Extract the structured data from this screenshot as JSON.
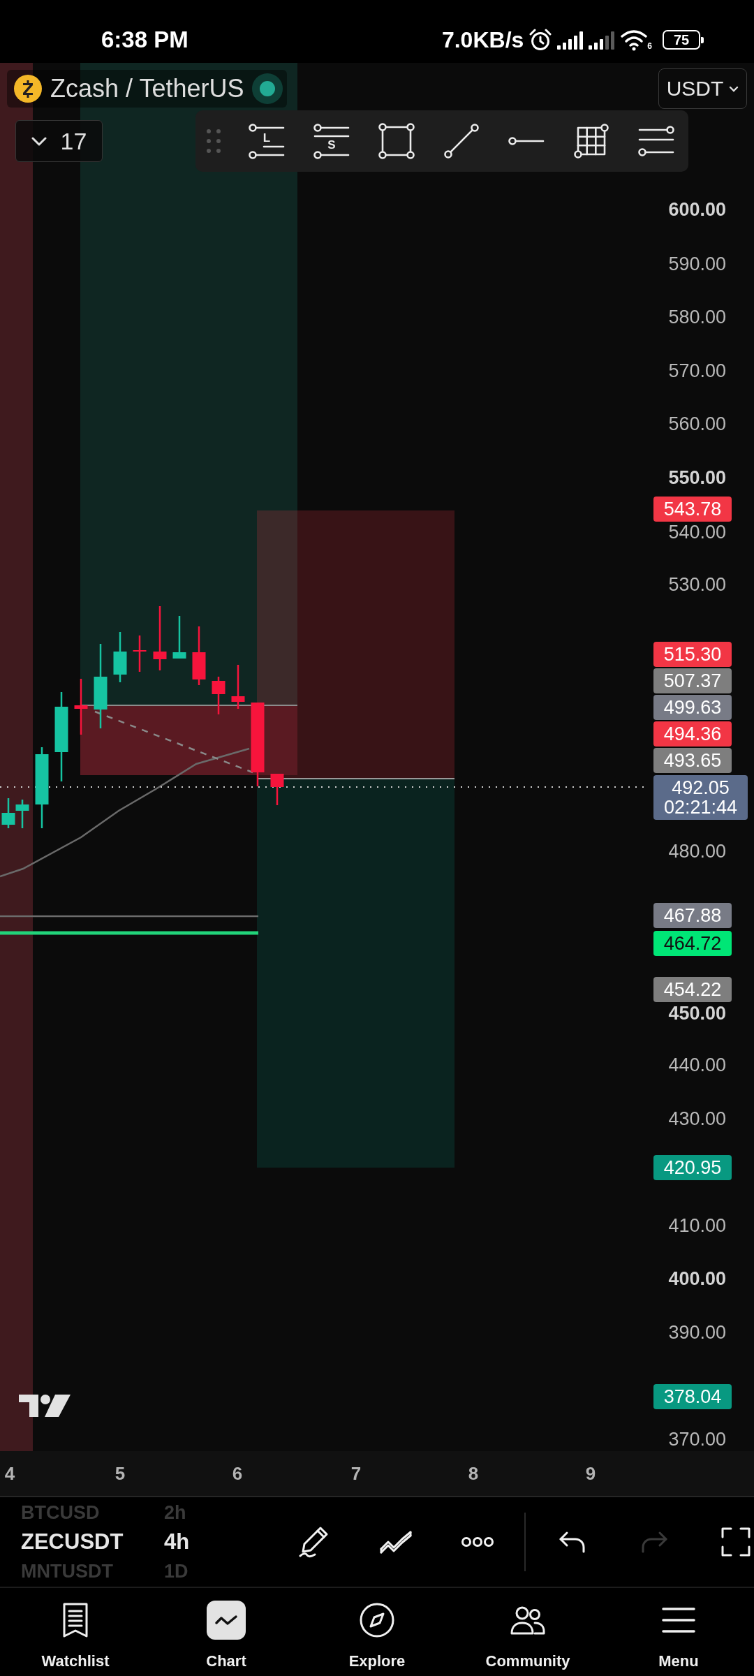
{
  "status_bar": {
    "time": "6:38 PM",
    "network_speed": "7.0KB/s",
    "wifi_label": "6",
    "battery": "75"
  },
  "header": {
    "symbol": "Zcash / TetherUS",
    "market_open": true,
    "indicators_toggle": "17",
    "currency": "USDT"
  },
  "drawing_toolbar": [
    {
      "kind": "long-position",
      "letter": "L"
    },
    {
      "kind": "short-position",
      "letter": "S"
    },
    {
      "kind": "rectangle"
    },
    {
      "kind": "trend-line"
    },
    {
      "kind": "horizontal-ray"
    },
    {
      "kind": "grid"
    },
    {
      "kind": "parallel-channel"
    }
  ],
  "price_axis": [
    {
      "text": "600.00",
      "major": true
    },
    {
      "text": "590.00",
      "major": false
    },
    {
      "text": "580.00",
      "major": false
    },
    {
      "text": "570.00",
      "major": false
    },
    {
      "text": "560.00",
      "major": false
    },
    {
      "text": "550.00",
      "major": true
    },
    {
      "text": "540.00",
      "major": false
    },
    {
      "text": "530.00",
      "major": false
    },
    {
      "text": "480.00",
      "major": false
    },
    {
      "text": "450.00",
      "major": true
    },
    {
      "text": "440.00",
      "major": false
    },
    {
      "text": "430.00",
      "major": false
    },
    {
      "text": "410.00",
      "major": false
    },
    {
      "text": "400.00",
      "major": true
    },
    {
      "text": "390.00",
      "major": false
    },
    {
      "text": "370.00",
      "major": false
    }
  ],
  "price_tags": [
    {
      "text": "543.78",
      "color": "#f23645"
    },
    {
      "text": "515.30",
      "color": "#f23645"
    },
    {
      "text": "507.37",
      "color": "#7e7e7e"
    },
    {
      "text": "499.63",
      "color": "#787b86"
    },
    {
      "text": "494.36",
      "color": "#f23645"
    },
    {
      "text": "493.65",
      "color": "#7e7e7e"
    },
    {
      "text": "492.05",
      "countdown": "02:21:44",
      "color": "#5b6b8a"
    },
    {
      "text": "467.88",
      "color": "#787b86"
    },
    {
      "text": "464.72",
      "color": "#00e676"
    },
    {
      "text": "454.22",
      "color": "#7e7e7e"
    },
    {
      "text": "420.95",
      "color": "#089981"
    },
    {
      "text": "378.04",
      "color": "#089981"
    }
  ],
  "time_axis": [
    "4",
    "5",
    "6",
    "7",
    "8",
    "9"
  ],
  "symbol_picker": [
    {
      "symbol": "BTCUSD",
      "interval": "2h",
      "selected": false
    },
    {
      "symbol": "ZECUSDT",
      "interval": "4h",
      "selected": true
    },
    {
      "symbol": "MNTUSDT",
      "interval": "1D",
      "selected": false
    }
  ],
  "bottom_toolbar": [
    {
      "kind": "draw",
      "disabled": false
    },
    {
      "kind": "zigzag",
      "disabled": false
    },
    {
      "kind": "more",
      "disabled": false
    },
    {
      "kind": "undo",
      "disabled": false
    },
    {
      "kind": "redo",
      "disabled": true
    },
    {
      "kind": "fullscreen",
      "disabled": false
    }
  ],
  "nav": [
    {
      "kind": "watchlist",
      "label": "Watchlist",
      "selected": false
    },
    {
      "kind": "chart",
      "label": "Chart",
      "selected": true
    },
    {
      "kind": "explore",
      "label": "Explore",
      "selected": false
    },
    {
      "kind": "community",
      "label": "Community",
      "selected": false
    },
    {
      "kind": "menu",
      "label": "Menu",
      "selected": false
    }
  ]
}
